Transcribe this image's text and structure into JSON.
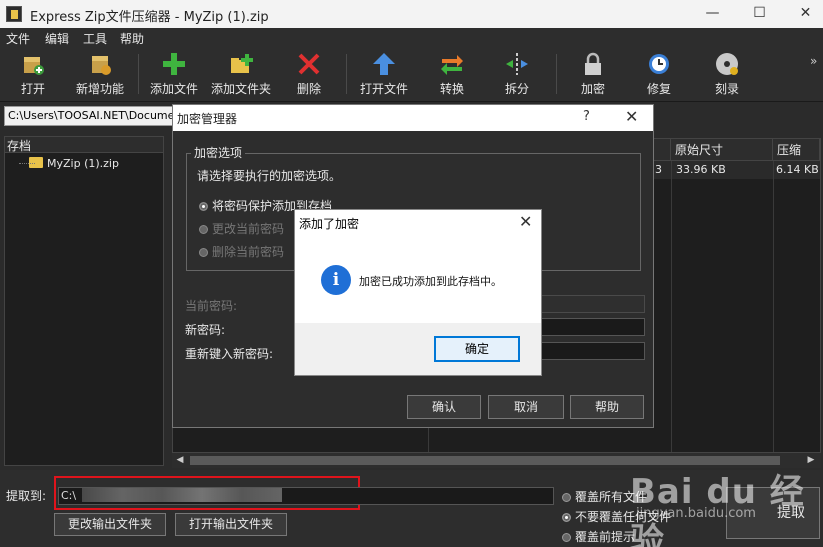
{
  "window": {
    "title": "Express Zip文件压缩器 - MyZip (1).zip",
    "controls": {
      "minimize": "—",
      "maximize": "☐",
      "close": "✕"
    }
  },
  "menubar": {
    "items": [
      "文件",
      "编辑",
      "工具",
      "帮助"
    ]
  },
  "toolbar": {
    "items": [
      {
        "label": "打开",
        "icon": "open-archive-icon"
      },
      {
        "label": "新增功能",
        "icon": "new-features-icon"
      },
      {
        "label": "添加文件",
        "icon": "add-file-icon"
      },
      {
        "label": "添加文件夹",
        "icon": "add-folder-icon"
      },
      {
        "label": "删除",
        "icon": "delete-icon"
      },
      {
        "label": "打开文件",
        "icon": "open-file-icon"
      },
      {
        "label": "转换",
        "icon": "convert-icon"
      },
      {
        "label": "拆分",
        "icon": "split-icon"
      },
      {
        "label": "加密",
        "icon": "encrypt-icon"
      },
      {
        "label": "修复",
        "icon": "repair-icon"
      },
      {
        "label": "刻录",
        "icon": "burn-icon"
      }
    ],
    "overflow": "»"
  },
  "path": {
    "value": "C:\\Users\\TOOSAI.NET\\Documents"
  },
  "tree": {
    "header": "存档",
    "nodes": [
      {
        "label": "MyZip (1).zip"
      }
    ]
  },
  "filelist": {
    "columns": [
      "原始尺寸",
      "压缩"
    ],
    "rows": [
      {
        "trunc": "3",
        "original_size": "33.96 KB",
        "compressed": "6.14 KB"
      }
    ]
  },
  "bottom": {
    "extract_label": "提取到:",
    "extract_path": "C:\\",
    "change_output_button": "更改输出文件夹",
    "open_output_button": "打开输出文件夹",
    "radios": [
      {
        "label": "覆盖所有文件",
        "selected": false
      },
      {
        "label": "不要覆盖任何文件",
        "selected": true
      },
      {
        "label": "覆盖前提示",
        "selected": false
      }
    ],
    "extract_button": "提取"
  },
  "encryption_dialog": {
    "title": "加密管理器",
    "help": "?",
    "close": "✕",
    "group_title": "加密选项",
    "prompt": "请选择要执行的加密选项。",
    "options": [
      {
        "label": "将密码保护添加到存档",
        "selected": true,
        "enabled": true
      },
      {
        "label": "更改当前密码",
        "selected": false,
        "enabled": false
      },
      {
        "label": "删除当前密码",
        "selected": false,
        "enabled": false
      }
    ],
    "fields": {
      "current_password": "当前密码:",
      "new_password": "新密码:",
      "reenter_password": "重新键入新密码:"
    },
    "buttons": {
      "confirm": "确认",
      "cancel": "取消",
      "help": "帮助"
    }
  },
  "message_box": {
    "title": "添加了加密",
    "close": "✕",
    "icon": "info-icon",
    "message": "加密已成功添加到此存档中。",
    "ok": "确定"
  },
  "watermark": {
    "brand": "Bai du 经验",
    "url": "jingyan.baidu.com"
  }
}
